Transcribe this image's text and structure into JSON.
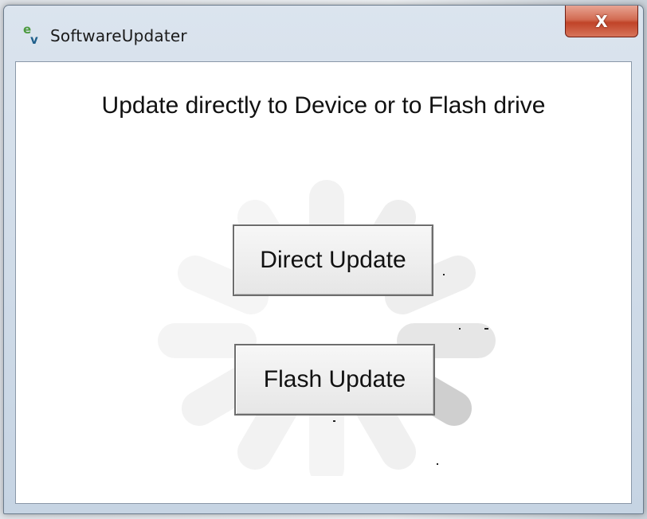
{
  "window": {
    "title": "SoftwareUpdater",
    "app_icon": "ev-logo-icon",
    "close_label": "X",
    "accent_close": "#c8482e"
  },
  "main": {
    "heading": "Update directly to Device or to Flash drive",
    "direct_update_label": "Direct Update",
    "flash_update_label": "Flash Update",
    "spinner_icon": "loading-spinner-icon"
  }
}
